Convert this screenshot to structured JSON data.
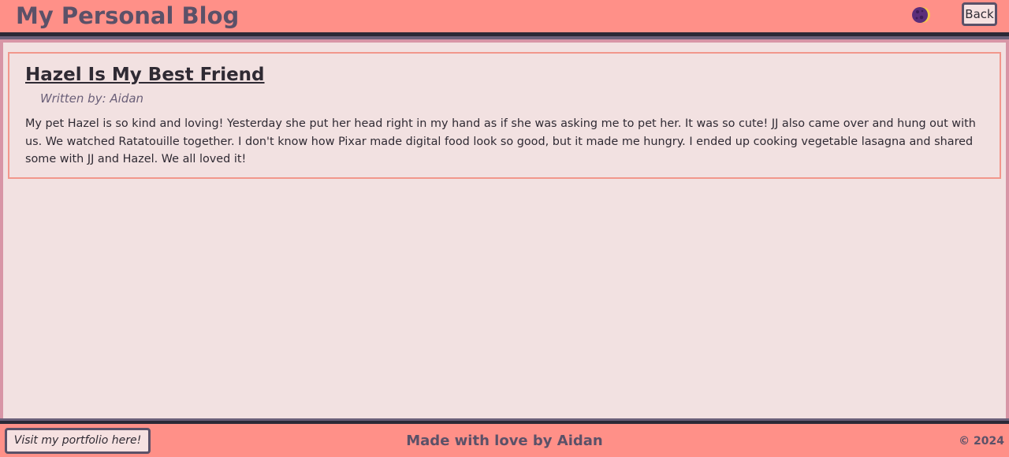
{
  "header": {
    "site_title": "My Personal Blog",
    "theme_toggle_icon": "moon-icon",
    "back_label": "Back"
  },
  "post": {
    "title": "Hazel Is My Best Friend",
    "author": "Written by: Aidan",
    "body": "My pet Hazel is so kind and loving! Yesterday she put her head right in my hand as if she was asking me to pet her. It was so cute! JJ also came over and hung out with us. We watched Ratatouille together. I don't know how Pixar made digital food look so good, but it made me hungry. I ended up cooking vegetable lasagna and shared some with JJ and Hazel. We all loved it!"
  },
  "footer": {
    "portfolio_label": "Visit my portfolio here!",
    "credit": "Made with love by Aidan",
    "copyright": "© 2024"
  },
  "colors": {
    "header_bg": "#ff9088",
    "page_bg": "#f2e1e1",
    "accent_text": "#5b5168",
    "card_border": "#f2978c",
    "dark_rule": "#2b2836"
  }
}
